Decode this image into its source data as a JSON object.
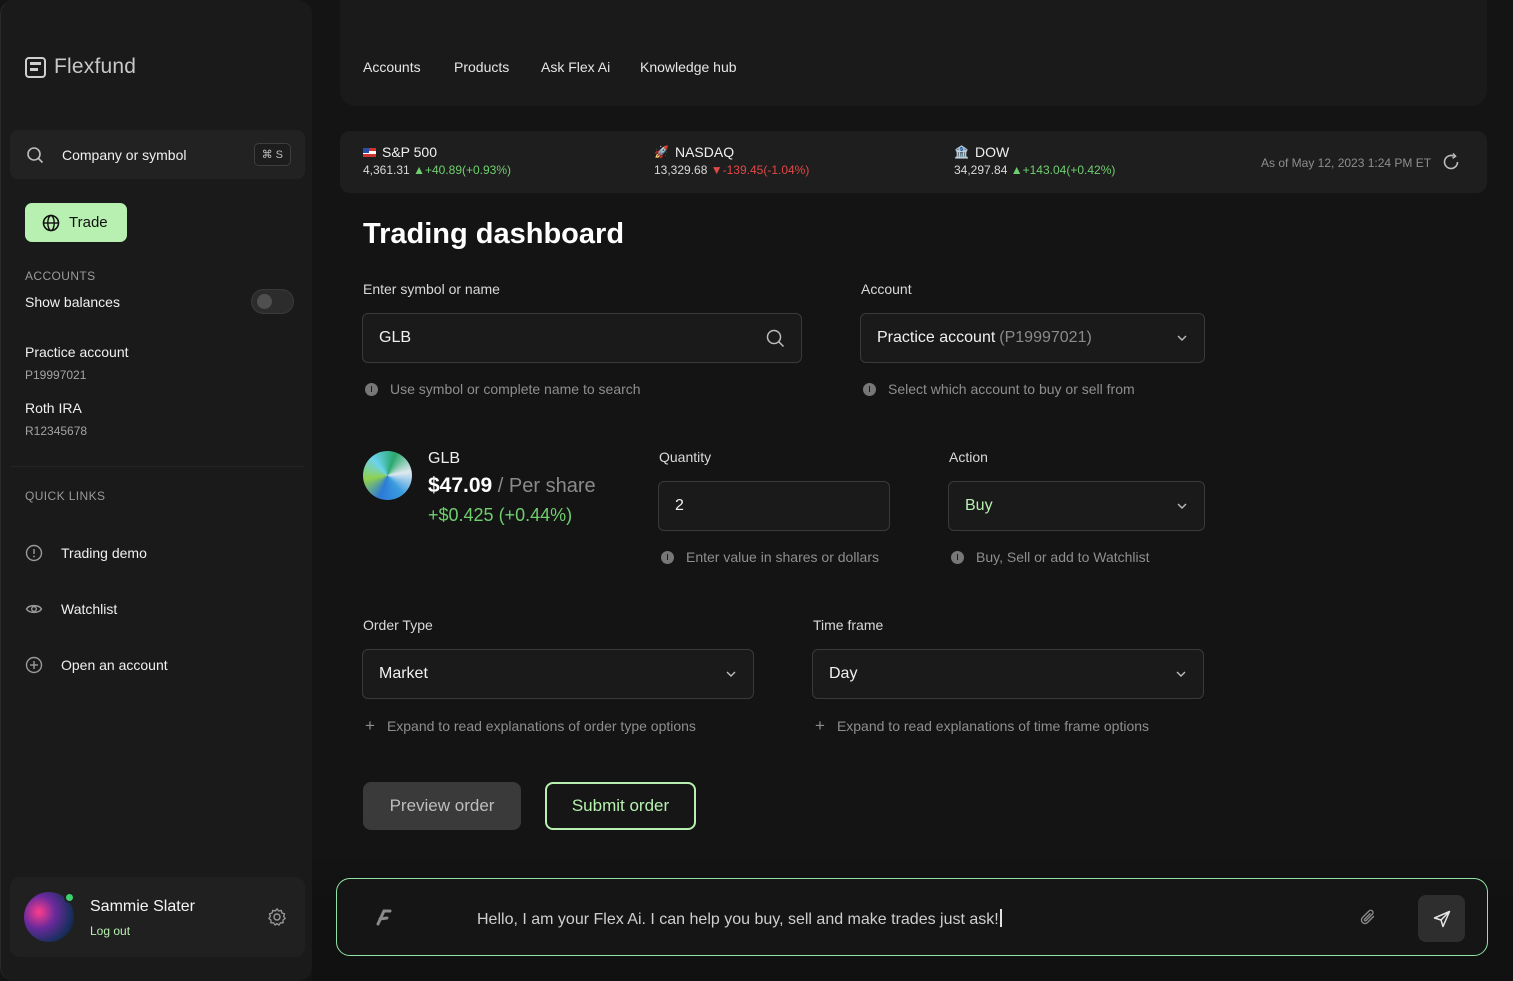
{
  "app": {
    "name": "Flexfund"
  },
  "sidebar": {
    "search_label": "Company or symbol",
    "search_shortcut": "⌘ S",
    "trade_label": "Trade",
    "accounts_title": "ACCOUNTS",
    "show_balances_label": "Show balances",
    "show_balances_on": false,
    "accounts": [
      {
        "name": "Practice account",
        "id": "P19997021"
      },
      {
        "name": "Roth IRA",
        "id": "R12345678"
      }
    ],
    "quick_links_title": "QUICK LINKS",
    "quick_links": [
      {
        "label": "Trading demo",
        "icon": "info-circle-icon"
      },
      {
        "label": "Watchlist",
        "icon": "eye-icon"
      },
      {
        "label": "Open an account",
        "icon": "plus-circle-icon"
      }
    ],
    "user": {
      "name": "Sammie Slater",
      "logout_label": "Log out",
      "status": "online"
    }
  },
  "topnav": {
    "items": [
      "Accounts",
      "Products",
      "Ask  Flex Ai",
      "Knowledge hub"
    ]
  },
  "ticker": {
    "indices": [
      {
        "name": "S&P 500",
        "icon": "us-flag-icon",
        "value": "4,361.31",
        "change": "+40.89(+0.93%)",
        "direction": "up"
      },
      {
        "name": "NASDAQ",
        "icon": "rocket-icon",
        "value": "13,329.68",
        "change": "-139.45(-1.04%)",
        "direction": "down"
      },
      {
        "name": "DOW",
        "icon": "bank-icon",
        "value": "34,297.84",
        "change": "+143.04(+0.42%)",
        "direction": "up"
      }
    ],
    "as_of": "As of May 12, 2023 1:24 PM ET"
  },
  "main": {
    "title": "Trading dashboard",
    "symbol": {
      "label": "Enter symbol or name",
      "value": "GLB",
      "hint": "Use symbol or complete name to search"
    },
    "account": {
      "label": "Account",
      "value": "Practice account",
      "value_id": "(P19997021)",
      "hint": "Select which account  to  buy or sell from"
    },
    "stock": {
      "symbol": "GLB",
      "price": "$47.09",
      "per": " / Per share",
      "change": "+$0.425 (+0.44%)"
    },
    "quantity": {
      "label": "Quantity",
      "value": "2",
      "hint": "Enter value in shares or dollars"
    },
    "action": {
      "label": "Action",
      "value": "Buy",
      "hint": "Buy, Sell or add to Watchlist"
    },
    "order_type": {
      "label": "Order Type",
      "value": "Market",
      "hint": "Expand to read explanations of order type options"
    },
    "time_frame": {
      "label": "Time frame",
      "value": "Day",
      "hint": "Expand to read explanations of time frame options"
    },
    "preview_label": "Preview order",
    "submit_label": "Submit order"
  },
  "chat": {
    "message": "Hello, I am your Flex Ai. I can help you buy, sell and make trades just ask!"
  },
  "colors": {
    "accent": "#b7f0b0",
    "up": "#6fcf6f",
    "down": "#e04848",
    "background": "#141414"
  }
}
